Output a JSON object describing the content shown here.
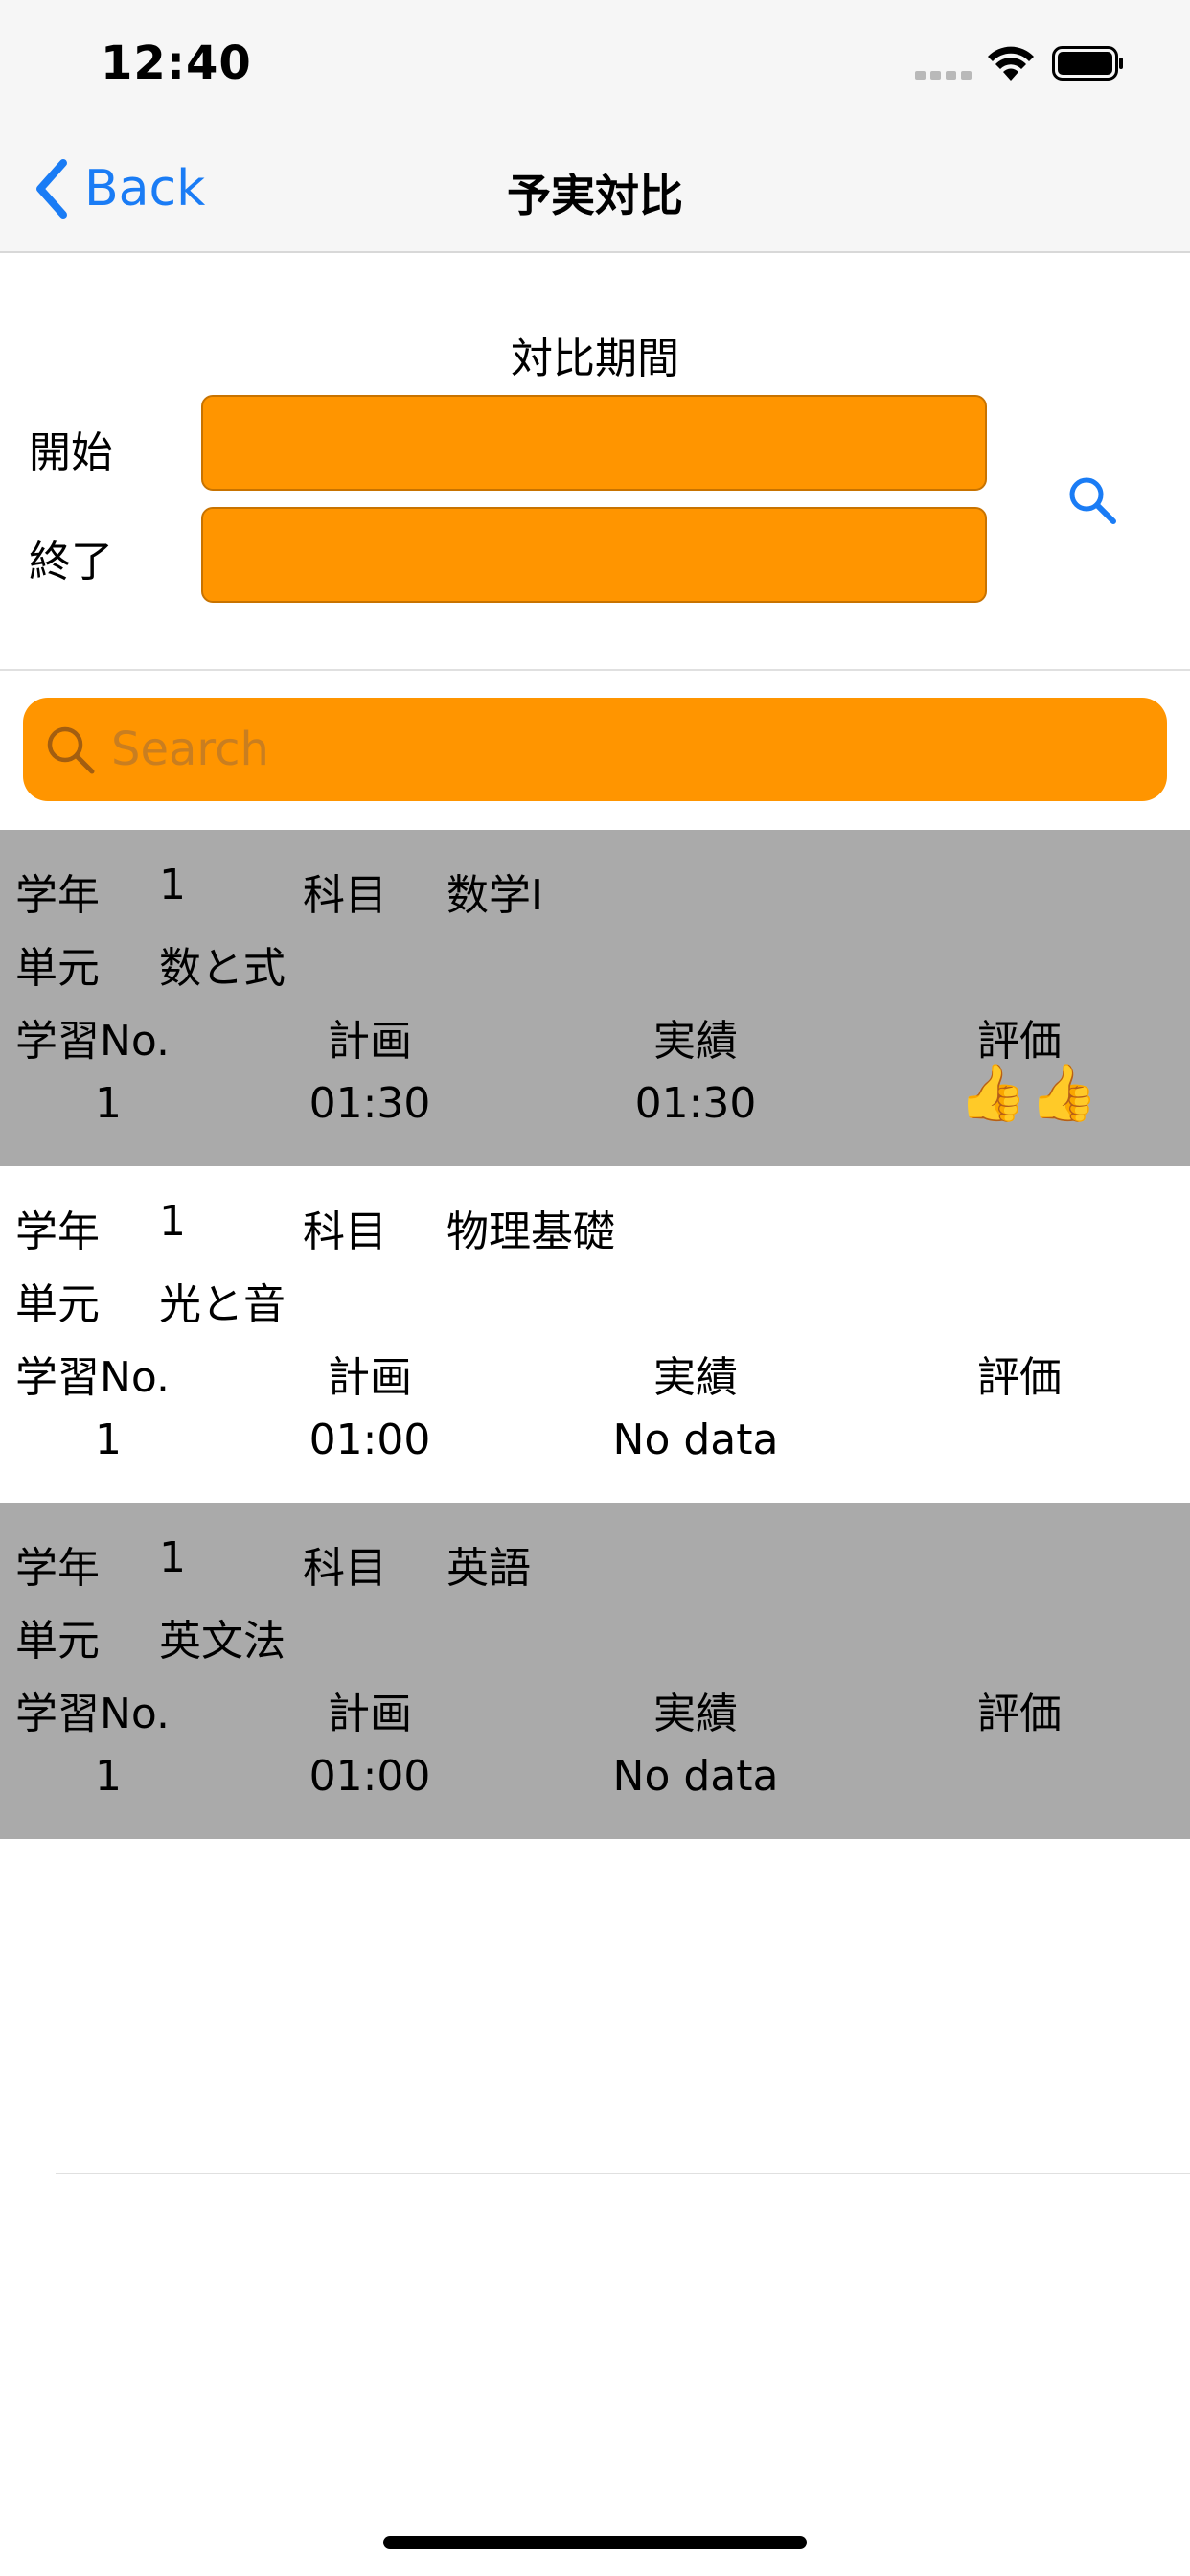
{
  "status_bar": {
    "time": "12:40"
  },
  "nav": {
    "back_label": "Back",
    "title": "予実対比"
  },
  "period": {
    "heading": "対比期間",
    "start_label": "開始",
    "end_label": "終了",
    "start_value": "",
    "end_value": ""
  },
  "search": {
    "placeholder": "Search",
    "value": ""
  },
  "labels": {
    "grade": "学年",
    "subject": "科目",
    "unit": "単元",
    "study_no": "学習No.",
    "plan": "計画",
    "actual": "実績",
    "evaluation": "評価"
  },
  "records": [
    {
      "grade": "1",
      "subject": "数学I",
      "unit": "数と式",
      "no": "1",
      "plan": "01:30",
      "actual": "01:30",
      "evaluation": "👍👍"
    },
    {
      "grade": "1",
      "subject": "物理基礎",
      "unit": "光と音",
      "no": "1",
      "plan": "01:00",
      "actual": "No data",
      "evaluation": ""
    },
    {
      "grade": "1",
      "subject": "英語",
      "unit": "英文法",
      "no": "1",
      "plan": "01:00",
      "actual": "No data",
      "evaluation": ""
    }
  ],
  "colors": {
    "accent": "#1a7cf5",
    "orange": "#ff9500",
    "row_gray": "#aaaaaa"
  },
  "icons": [
    "chevron-left-icon",
    "search-icon",
    "wifi-icon",
    "battery-icon",
    "signal-icon"
  ]
}
